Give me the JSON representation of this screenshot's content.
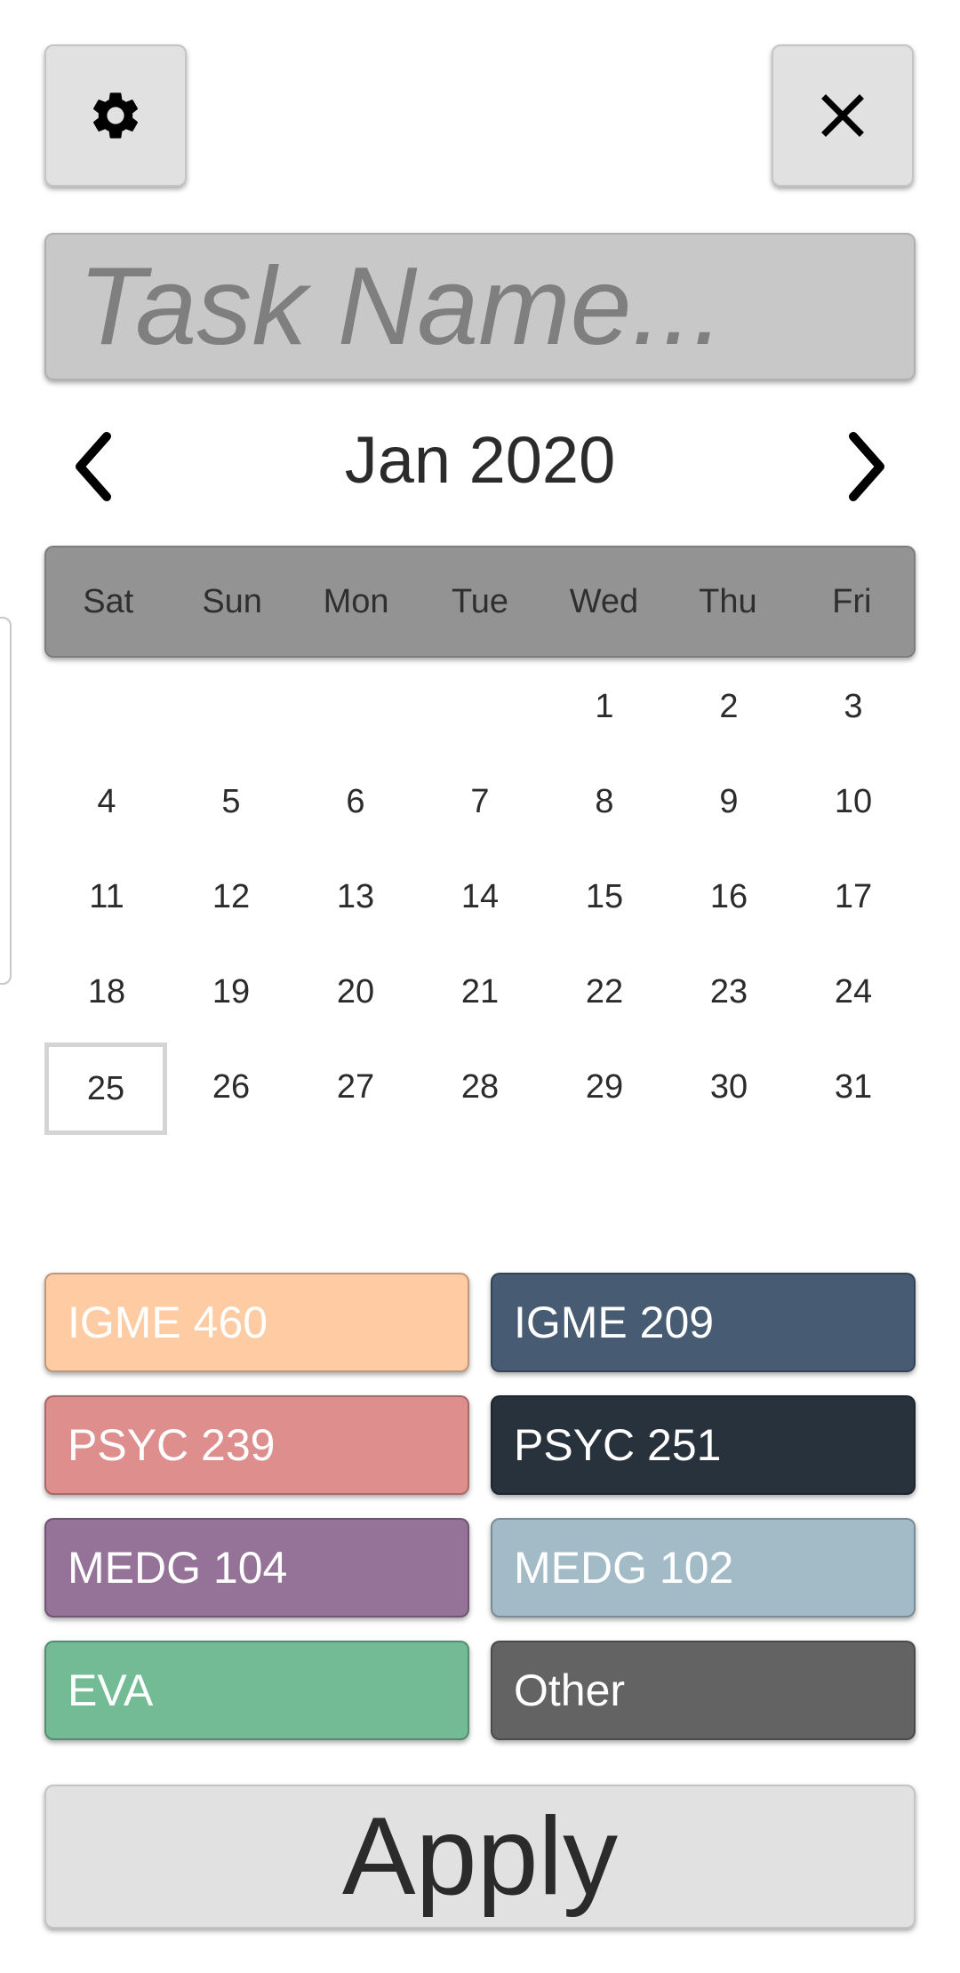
{
  "task_input": {
    "placeholder": "Task Name..."
  },
  "calendar": {
    "month_title": "Jan 2020",
    "weekdays": [
      "Sat",
      "Sun",
      "Mon",
      "Tue",
      "Wed",
      "Thu",
      "Fri"
    ],
    "leading_blanks": 4,
    "days": [
      "1",
      "2",
      "3",
      "4",
      "5",
      "6",
      "7",
      "8",
      "9",
      "10",
      "11",
      "12",
      "13",
      "14",
      "15",
      "16",
      "17",
      "18",
      "19",
      "20",
      "21",
      "22",
      "23",
      "24",
      "25",
      "26",
      "27",
      "28",
      "29",
      "30",
      "31"
    ],
    "highlighted_day": "25"
  },
  "courses": [
    {
      "label": "IGME 460",
      "color": "#fecba2"
    },
    {
      "label": "IGME 209",
      "color": "#475b72"
    },
    {
      "label": "PSYC 239",
      "color": "#de8e8d"
    },
    {
      "label": "PSYC 251",
      "color": "#27323c"
    },
    {
      "label": "MEDG 104",
      "color": "#957297"
    },
    {
      "label": "MEDG 102",
      "color": "#a2bbc7"
    },
    {
      "label": "EVA",
      "color": "#72bb94"
    },
    {
      "label": "Other",
      "color": "#636363"
    }
  ],
  "icons": {
    "settings": "gear-icon",
    "close": "close-icon",
    "prev": "chevron-left-icon",
    "next": "chevron-right-icon"
  },
  "apply_label": "Apply"
}
